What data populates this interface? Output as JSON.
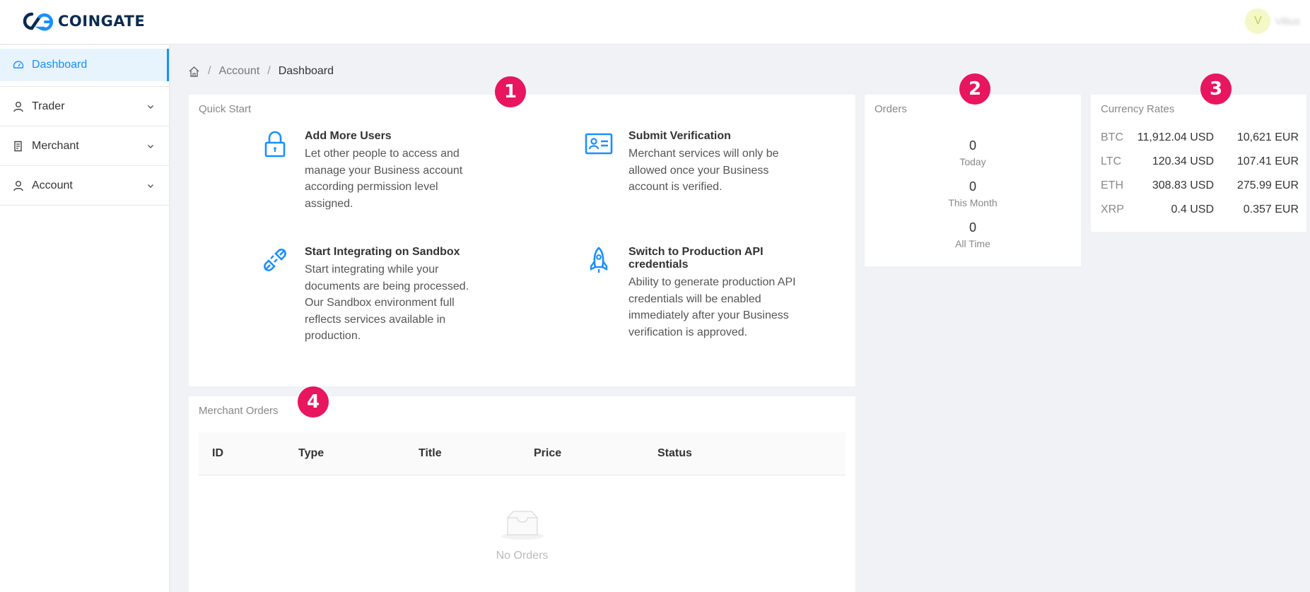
{
  "header": {
    "logo_text": "COINGATE",
    "avatar_initial": "V",
    "username": "Vilius"
  },
  "sidebar": {
    "items": [
      {
        "label": "Dashboard",
        "icon": "dashboard-icon",
        "active": true
      },
      {
        "label": "Trader",
        "icon": "user-icon"
      },
      {
        "label": "Merchant",
        "icon": "receipt-icon"
      },
      {
        "label": "Account",
        "icon": "user-icon"
      }
    ]
  },
  "breadcrumb": {
    "items": [
      "Account",
      "Dashboard"
    ],
    "separator": "/"
  },
  "quick_start": {
    "title": "Quick Start",
    "items": [
      {
        "icon": "lock-icon",
        "title": "Add More Users",
        "text": "Let other people to access and manage your Business account according permission level assigned."
      },
      {
        "icon": "id-card-icon",
        "title": "Submit Verification",
        "text": "Merchant services will only be allowed once your Business account is verified."
      },
      {
        "icon": "plug-icon",
        "title": "Start Integrating on Sandbox",
        "text": "Start integrating while your documents are being processed. Our Sandbox environment full reflects services available in production."
      },
      {
        "icon": "rocket-icon",
        "title": "Switch to Production API credentials",
        "text": "Ability to generate production API credentials will be enabled immediately after your Business verification is approved."
      }
    ]
  },
  "orders": {
    "title": "Orders",
    "stats": [
      {
        "value": "0",
        "label": "Today"
      },
      {
        "value": "0",
        "label": "This Month"
      },
      {
        "value": "0",
        "label": "All Time"
      }
    ]
  },
  "currency_rates": {
    "title": "Currency Rates",
    "rows": [
      {
        "symbol": "BTC",
        "usd": "11,912.04 USD",
        "eur": "10,621 EUR"
      },
      {
        "symbol": "LTC",
        "usd": "120.34 USD",
        "eur": "107.41 EUR"
      },
      {
        "symbol": "ETH",
        "usd": "308.83 USD",
        "eur": "275.99 EUR"
      },
      {
        "symbol": "XRP",
        "usd": "0.4 USD",
        "eur": "0.357 EUR"
      }
    ]
  },
  "merchant_orders": {
    "title": "Merchant Orders",
    "columns": [
      "ID",
      "Type",
      "Title",
      "Price",
      "Status"
    ],
    "empty_text": "No Orders"
  },
  "annotations": [
    "1",
    "2",
    "3",
    "4"
  ],
  "colors": {
    "accent": "#1890ff",
    "badge": "#e8155f",
    "logo": "#0b2b4f"
  }
}
